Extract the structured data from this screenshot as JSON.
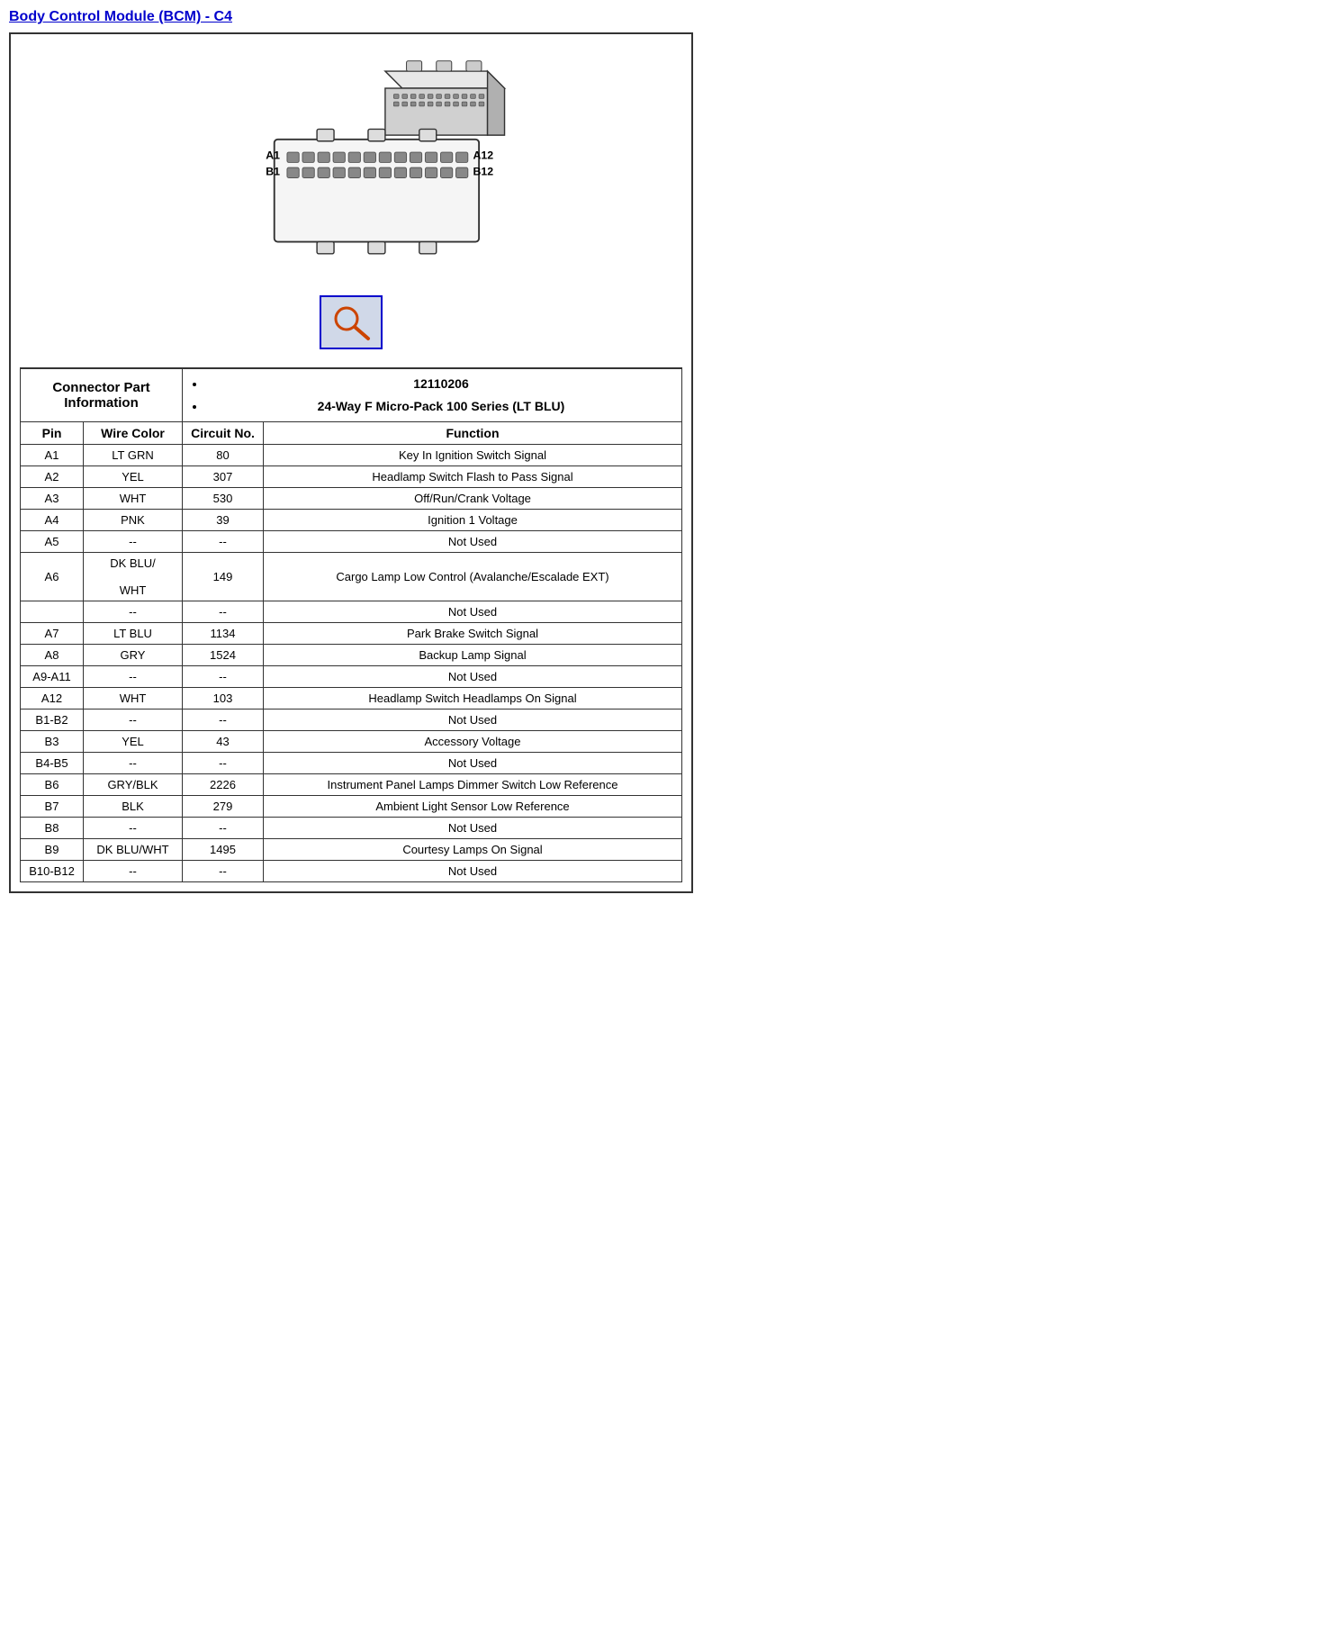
{
  "title": "Body Control Module (BCM) - C4",
  "connector_info_label": "Connector Part Information",
  "part_info": [
    "12110206",
    "24-Way F Micro-Pack 100 Series (LT BLU)"
  ],
  "table_headers": {
    "pin": "Pin",
    "wire_color": "Wire Color",
    "circuit_no": "Circuit No.",
    "function": "Function"
  },
  "rows": [
    {
      "pin": "A1",
      "wire_color": "LT GRN",
      "circuit_no": "80",
      "function": "Key In Ignition Switch Signal"
    },
    {
      "pin": "A2",
      "wire_color": "YEL",
      "circuit_no": "307",
      "function": "Headlamp Switch Flash to Pass Signal"
    },
    {
      "pin": "A3",
      "wire_color": "WHT",
      "circuit_no": "530",
      "function": "Off/Run/Crank Voltage"
    },
    {
      "pin": "A4",
      "wire_color": "PNK",
      "circuit_no": "39",
      "function": "Ignition 1 Voltage"
    },
    {
      "pin": "A5",
      "wire_color": "--",
      "circuit_no": "--",
      "function": "Not Used"
    },
    {
      "pin": "A6",
      "wire_color": "DK BLU/\n\nWHT",
      "circuit_no": "149",
      "function": "Cargo Lamp Low Control (Avalanche/Escalade EXT)"
    },
    {
      "pin": "",
      "wire_color": "--",
      "circuit_no": "--",
      "function": "Not Used"
    },
    {
      "pin": "A7",
      "wire_color": "LT BLU",
      "circuit_no": "1134",
      "function": "Park Brake Switch Signal"
    },
    {
      "pin": "A8",
      "wire_color": "GRY",
      "circuit_no": "1524",
      "function": "Backup Lamp Signal"
    },
    {
      "pin": "A9-A11",
      "wire_color": "--",
      "circuit_no": "--",
      "function": "Not Used"
    },
    {
      "pin": "A12",
      "wire_color": "WHT",
      "circuit_no": "103",
      "function": "Headlamp Switch Headlamps On Signal"
    },
    {
      "pin": "B1-B2",
      "wire_color": "--",
      "circuit_no": "--",
      "function": "Not Used"
    },
    {
      "pin": "B3",
      "wire_color": "YEL",
      "circuit_no": "43",
      "function": "Accessory Voltage"
    },
    {
      "pin": "B4-B5",
      "wire_color": "--",
      "circuit_no": "--",
      "function": "Not Used"
    },
    {
      "pin": "B6",
      "wire_color": "GRY/BLK",
      "circuit_no": "2226",
      "function": "Instrument Panel Lamps Dimmer Switch Low Reference"
    },
    {
      "pin": "B7",
      "wire_color": "BLK",
      "circuit_no": "279",
      "function": "Ambient Light Sensor Low Reference"
    },
    {
      "pin": "B8",
      "wire_color": "--",
      "circuit_no": "--",
      "function": "Not Used"
    },
    {
      "pin": "B9",
      "wire_color": "DK BLU/WHT",
      "circuit_no": "1495",
      "function": "Courtesy Lamps On Signal"
    },
    {
      "pin": "B10-B12",
      "wire_color": "--",
      "circuit_no": "--",
      "function": "Not Used"
    }
  ]
}
